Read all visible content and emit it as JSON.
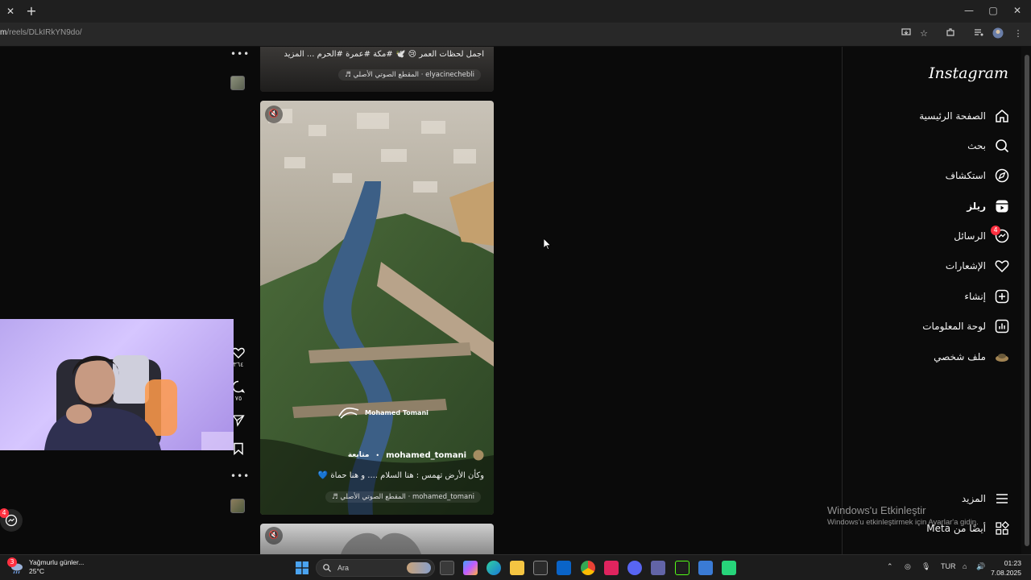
{
  "browser": {
    "url_prefix": "m",
    "url_path": "/reels/DLkIRkYN9do/"
  },
  "nav": {
    "logo": "Instagram",
    "items": [
      {
        "label": "الصفحة الرئيسية",
        "icon": "home-icon"
      },
      {
        "label": "بحث",
        "icon": "search-icon"
      },
      {
        "label": "استكشاف",
        "icon": "compass-icon"
      },
      {
        "label": "ريلز",
        "icon": "reels-icon"
      },
      {
        "label": "الرسائل",
        "icon": "messenger-icon",
        "badge": "4"
      },
      {
        "label": "الإشعارات",
        "icon": "heart-icon"
      },
      {
        "label": "إنشاء",
        "icon": "plus-square-icon"
      },
      {
        "label": "لوحة المعلومات",
        "icon": "dashboard-icon"
      },
      {
        "label": "ملف شخصي",
        "icon": "avatar-icon"
      }
    ],
    "more_label": "المزيد",
    "meta_label": "أيضًا من Meta"
  },
  "reel_prev": {
    "caption": "اجمل لحظات العمر 😢 🕊️ #مكة #عمرة #الحرم ... المزيد",
    "audio": "elyacinechebli · المقطع الصوتي الأصلي ♬"
  },
  "reel_main": {
    "watermark": "Mohamed Tomani",
    "username": "mohamed_tomani",
    "follow_label": "متابعة",
    "caption": "وكأن الأرض تهمس : هنا السلام .... و هنا حماة 💙",
    "audio": "mohamed_tomani · المقطع الصوتي الأصلي ♬",
    "likes": "٣٦٤",
    "comments": "٧٥"
  },
  "windows": {
    "activate_title": "Windows'u Etkinleştir",
    "activate_sub": "Windows'u etkinleştirmek için Ayarlar'a gidin."
  },
  "taskbar": {
    "weather_text": "Yağmurlu günler...",
    "temperature": "25°C",
    "weather_badge": "3",
    "search_placeholder": "Ara",
    "lang": "TUR",
    "time": "01:23",
    "date": "7.08.2025",
    "chat_badge": "4"
  },
  "colors": {
    "badge": "#ff3040",
    "page_bg": "#0a0a0a",
    "nav_border": "#262626"
  }
}
